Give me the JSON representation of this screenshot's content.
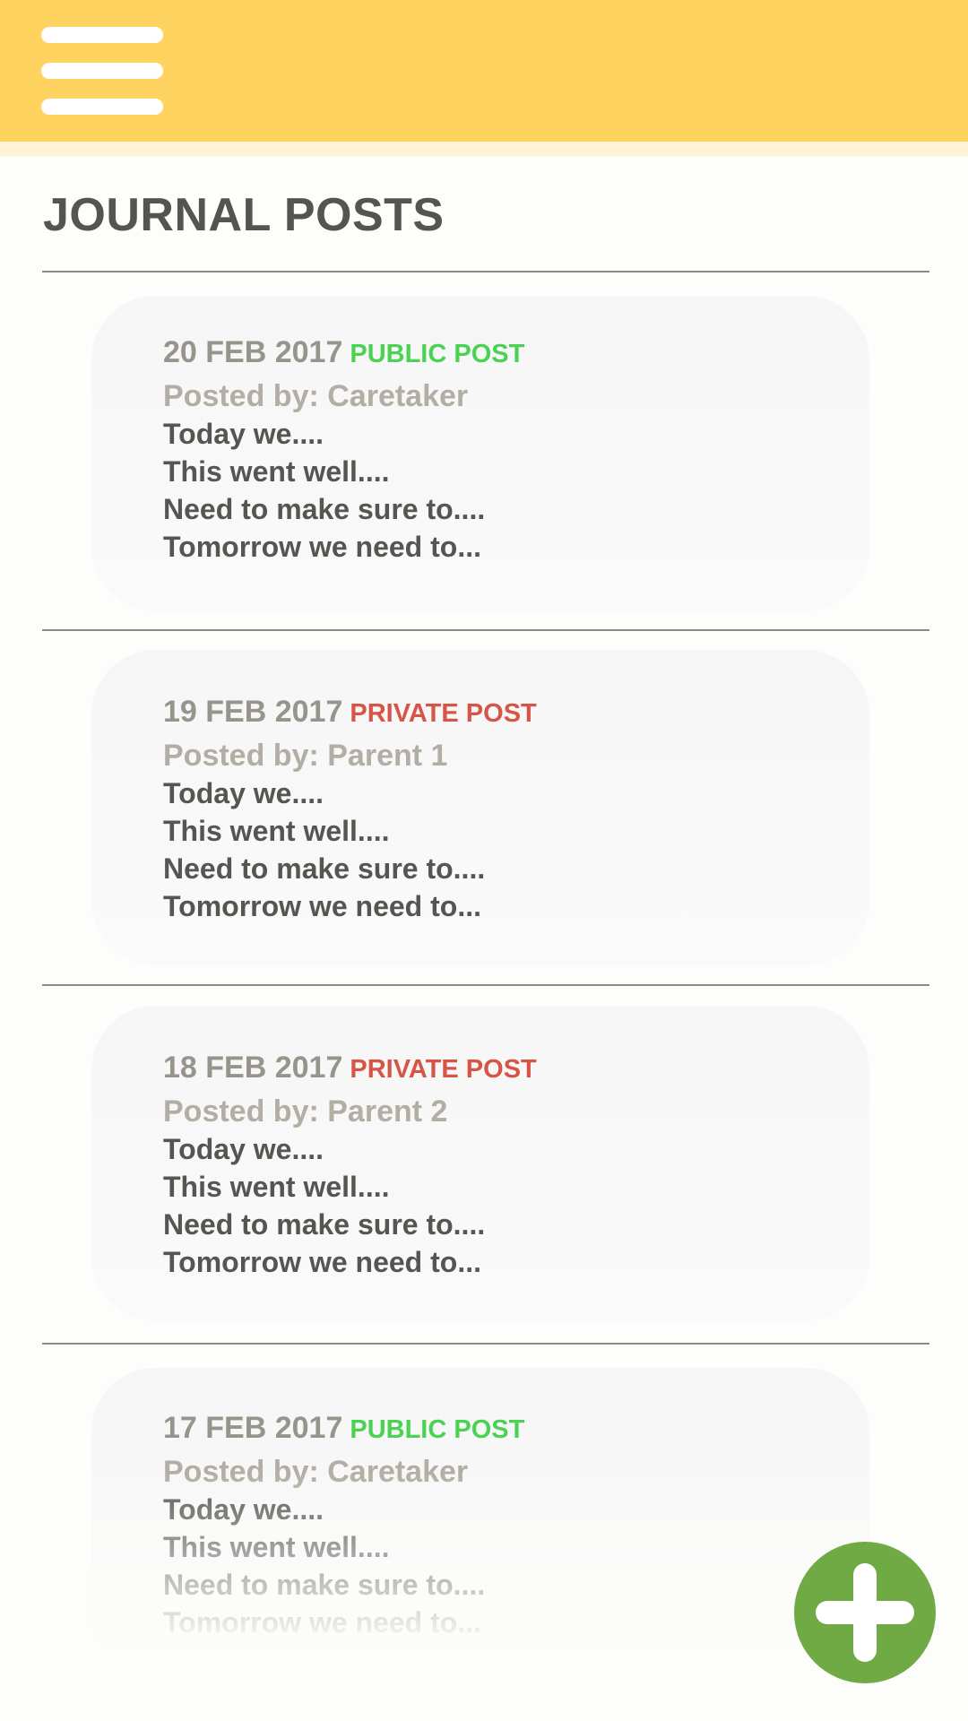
{
  "header": {
    "menu_icon": "menu-icon",
    "background_color": "#ffd35f"
  },
  "page": {
    "title": "JOURNAL POSTS"
  },
  "posts": [
    {
      "date": "20 FEB 2017",
      "visibility": "PUBLIC POST",
      "visibility_color": "#4bd255",
      "author": "Posted by: Caretaker",
      "lines": [
        "Today we....",
        "This went well....",
        "Need to make sure to....",
        "Tomorrow we need to..."
      ]
    },
    {
      "date": "19 FEB 2017",
      "visibility": "PRIVATE POST",
      "visibility_color": "#d75547",
      "author": "Posted by: Parent 1",
      "lines": [
        "Today we....",
        "This went well....",
        "Need to make sure to....",
        "Tomorrow we need to..."
      ]
    },
    {
      "date": "18 FEB 2017",
      "visibility": "PRIVATE POST",
      "visibility_color": "#d75547",
      "author": "Posted by: Parent 2",
      "lines": [
        "Today we....",
        "This went well....",
        "Need to make sure to....",
        "Tomorrow we need to..."
      ]
    },
    {
      "date": "17 FEB 2017",
      "visibility": "PUBLIC POST",
      "visibility_color": "#4bd255",
      "author": "Posted by: Caretaker",
      "lines": [
        "Today we....",
        "This went well....",
        "Need to make sure to....",
        "Tomorrow we need to..."
      ]
    }
  ],
  "fab": {
    "icon": "plus-icon",
    "color": "#6faa44"
  }
}
